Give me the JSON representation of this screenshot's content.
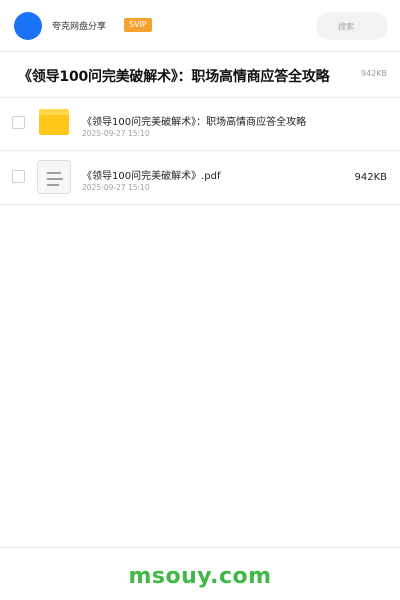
{
  "header": {
    "app_name": "夸克网盘分享",
    "badge": "SVIP",
    "search_placeholder": "搜索",
    "accent_color": "#1a73f5",
    "badge_color": "#f5a230"
  },
  "share": {
    "title": "《领导100问完美破解术》：职场高情商应答全攻略",
    "total_size": "942KB"
  },
  "files": [
    {
      "icon": "folder-icon",
      "name": "《领导100问完美破解术》：职场高情商应答全攻略",
      "date": "2025-09-27 15:10",
      "size": ""
    },
    {
      "icon": "document-icon",
      "name": "《领导100问完美破解术》.pdf",
      "date": "2025-09-27 15:10",
      "size": "942KB"
    }
  ],
  "footer": {
    "watermark": "msouy.com",
    "watermark_color": "#3fb846"
  }
}
